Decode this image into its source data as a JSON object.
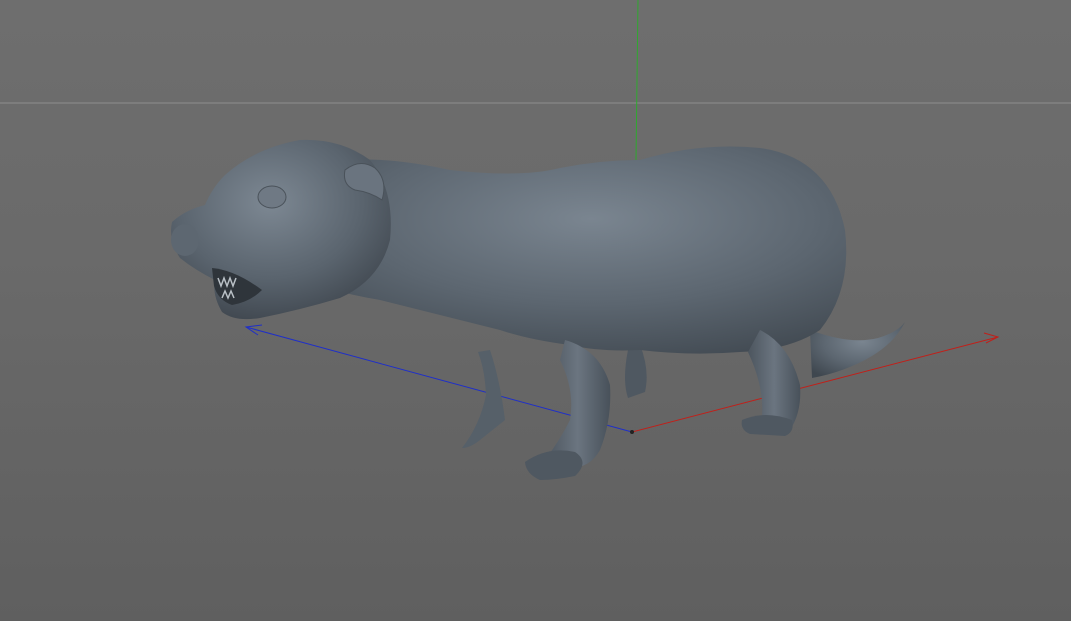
{
  "viewport": {
    "mode": "3d-perspective",
    "background": "#6a6a6a",
    "horizon_color": "#8a8a8a"
  },
  "axes": {
    "x_axis": {
      "name": "x-axis",
      "color": "#c0201a"
    },
    "y_axis": {
      "name": "y-axis",
      "color": "#2fa82f"
    },
    "z_axis": {
      "name": "z-axis",
      "color": "#1f2fc8"
    }
  },
  "model": {
    "name": "otter-model",
    "shading": "smooth-gray",
    "base_color": "#5b6570"
  }
}
